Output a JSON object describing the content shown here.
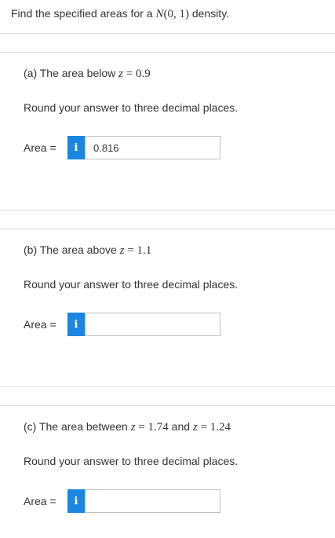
{
  "intro": {
    "text_before": "Find the specified areas for a ",
    "dist_prefix": "N",
    "dist_args": "(0, 1)",
    "text_after": " density."
  },
  "questions": [
    {
      "prompt_before": "(a) The area below ",
      "math": [
        {
          "var": "z",
          "expr": " = 0.9"
        }
      ],
      "between_text": "",
      "round_text": "Round your answer to three decimal places.",
      "area_label": "Area =",
      "info_icon": "i",
      "answer_value": "0.816"
    },
    {
      "prompt_before": "(b) The area above ",
      "math": [
        {
          "var": "z",
          "expr": " = 1.1"
        }
      ],
      "between_text": "",
      "round_text": "Round your answer to three decimal places.",
      "area_label": "Area =",
      "info_icon": "i",
      "answer_value": ""
    },
    {
      "prompt_before": "(c) The area between ",
      "math": [
        {
          "var": "z",
          "expr": " = 1.74"
        },
        {
          "var": "z",
          "expr": " = 1.24"
        }
      ],
      "between_text": " and ",
      "round_text": "Round your answer to three decimal places.",
      "area_label": "Area =",
      "info_icon": "i",
      "answer_value": ""
    }
  ],
  "colors": {
    "info_button": "#1b86e0",
    "divider": "#dddddd",
    "text": "#333333"
  }
}
